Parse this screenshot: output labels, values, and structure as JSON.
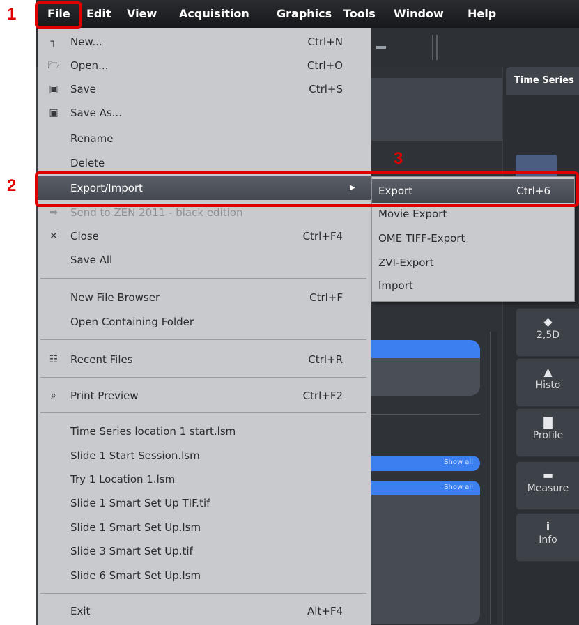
{
  "menubar": {
    "items": [
      "File",
      "Edit",
      "View",
      "Acquisition",
      "Graphics",
      "Tools",
      "Window",
      "Help"
    ]
  },
  "background": {
    "right_tab_title": "Time Series",
    "show_all_1": "Show all",
    "show_all_2": "Show all",
    "view_buttons": [
      {
        "label": "2,5D",
        "icon": "2.5d-icon"
      },
      {
        "label": "Histo",
        "icon": "histogram-icon"
      },
      {
        "label": "Profile",
        "icon": "profile-icon"
      },
      {
        "label": "Measure",
        "icon": "measure-icon"
      },
      {
        "label": "Info",
        "icon": "info-icon"
      }
    ]
  },
  "file_menu": {
    "items": [
      {
        "label": "New...",
        "shortcut": "Ctrl+N",
        "icon": "new-file-icon"
      },
      {
        "label": "Open...",
        "shortcut": "Ctrl+O",
        "icon": "folder-open-icon"
      },
      {
        "label": "Save",
        "shortcut": "Ctrl+S",
        "icon": "save-icon"
      },
      {
        "label": "Save As...",
        "shortcut": "",
        "icon": "save-as-icon"
      },
      {
        "label": "Rename",
        "shortcut": ""
      },
      {
        "label": "Delete",
        "shortcut": ""
      },
      {
        "label": "Export/Import",
        "shortcut": "",
        "highlighted": true,
        "has_submenu": true
      },
      {
        "label": "Send to ZEN 2011 - black edition",
        "shortcut": "",
        "disabled": true,
        "icon": "send-icon"
      },
      {
        "label": "Close",
        "shortcut": "Ctrl+F4",
        "icon": "close-icon"
      },
      {
        "label": "Save All",
        "shortcut": ""
      },
      {
        "label": "New File Browser",
        "shortcut": "Ctrl+F"
      },
      {
        "label": "Open Containing Folder",
        "shortcut": ""
      },
      {
        "label": "Recent Files",
        "shortcut": "Ctrl+R",
        "icon": "recent-files-icon"
      },
      {
        "label": "Print Preview",
        "shortcut": "Ctrl+F2",
        "icon": "print-preview-icon"
      },
      {
        "label": "Time Series location 1 start.lsm"
      },
      {
        "label": "Slide 1 Start Session.lsm"
      },
      {
        "label": "Try 1 Location 1.lsm"
      },
      {
        "label": "Slide 1 Smart Set Up TIF.tif"
      },
      {
        "label": "Slide 1 Smart Set Up.lsm"
      },
      {
        "label": "Slide 3 Smart Set Up.tif"
      },
      {
        "label": "Slide 6 Smart Set Up.lsm"
      },
      {
        "label": "Exit",
        "shortcut": "Alt+F4"
      }
    ]
  },
  "submenu": {
    "items": [
      {
        "label": "Export",
        "shortcut": "Ctrl+6",
        "highlighted": true
      },
      {
        "label": "Movie Export",
        "shortcut": ""
      },
      {
        "label": "OME TIFF-Export",
        "shortcut": ""
      },
      {
        "label": "ZVI-Export",
        "shortcut": ""
      },
      {
        "label": "Import",
        "shortcut": ""
      }
    ]
  },
  "annotations": {
    "step1": "1",
    "step2": "2",
    "step3": "3",
    "color": "#e00000"
  }
}
